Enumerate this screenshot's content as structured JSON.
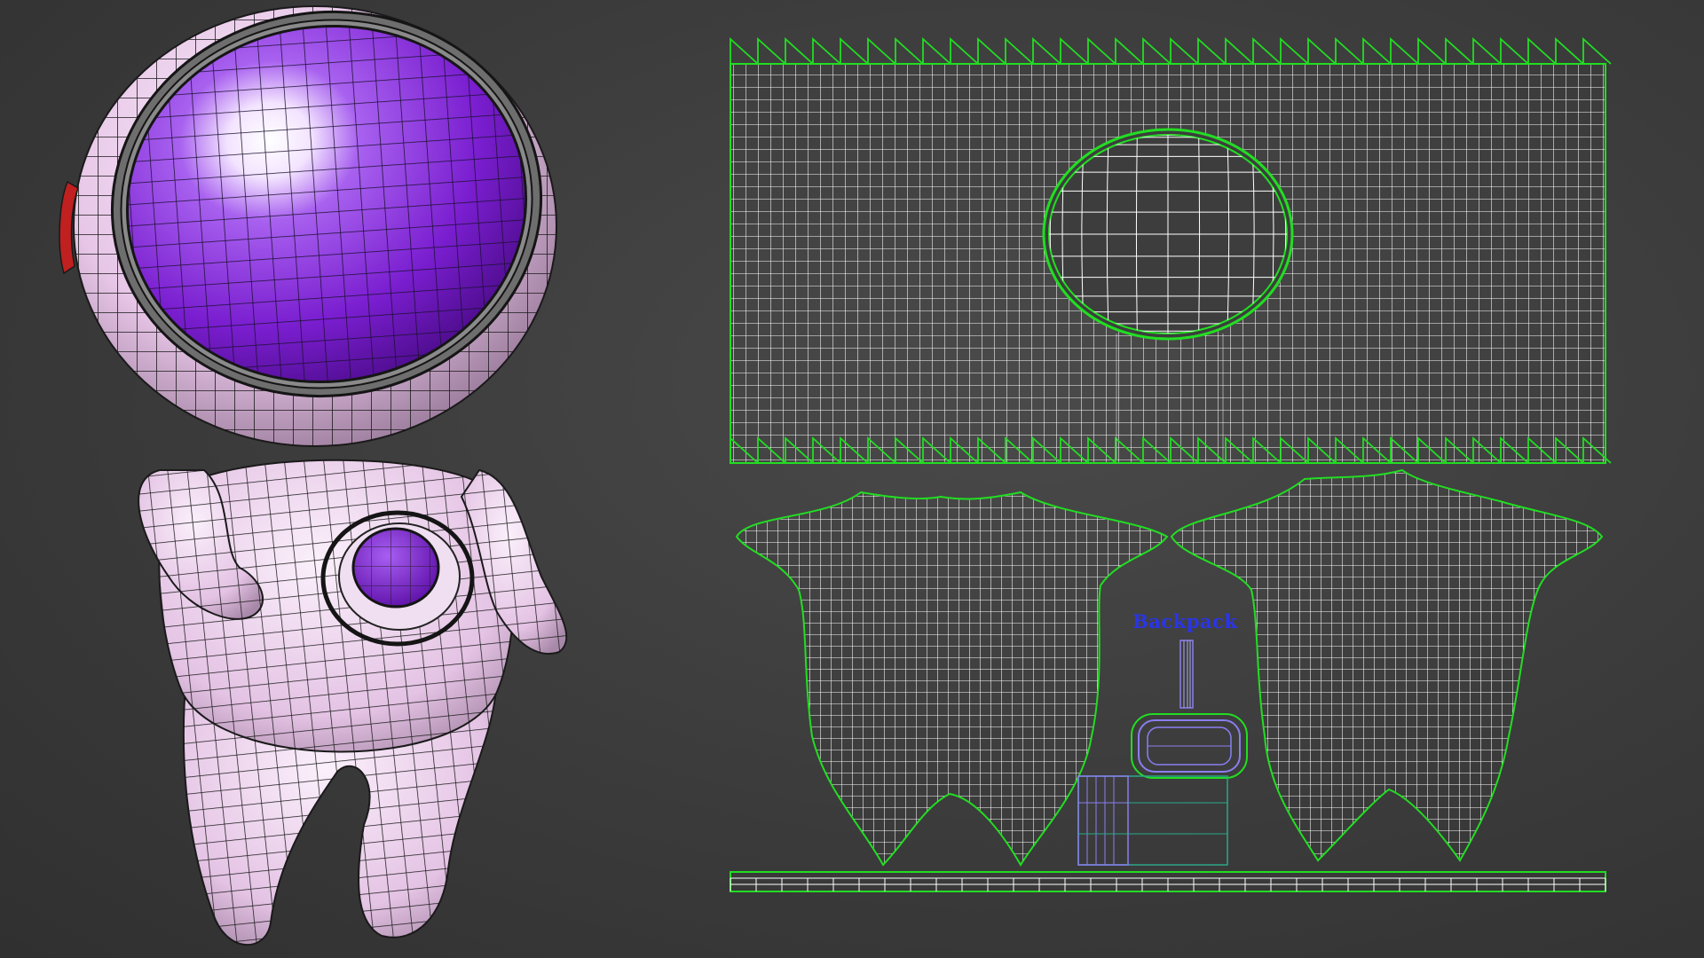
{
  "viewport": {
    "background_color": "#3d3d3d",
    "wire_color": "#ffffff",
    "seam_color": "#22dd22",
    "model_wire_color": "#111111"
  },
  "character_model": {
    "suit_color": "#e8c8e8",
    "visor_color": "#7a1ed0",
    "visor_rim_color": "#7a7a7a",
    "chest_emblem_color": "#7a1ed0",
    "side_light_color": "#c02020"
  },
  "uv_editor": {
    "shells": [
      {
        "name": "helmet-shell",
        "type": "grid-with-visor-ellipse"
      },
      {
        "name": "body-front-shell",
        "type": "body-unwrap"
      },
      {
        "name": "body-back-shell",
        "type": "body-unwrap"
      },
      {
        "name": "backpack-shells",
        "type": "small-parts"
      },
      {
        "name": "bottom-strip-shell",
        "type": "strip"
      }
    ],
    "backpack_label": "Backpack",
    "backpack_label_color": "#2a35e8",
    "backpack_wire_color": "#8a7ef0"
  }
}
